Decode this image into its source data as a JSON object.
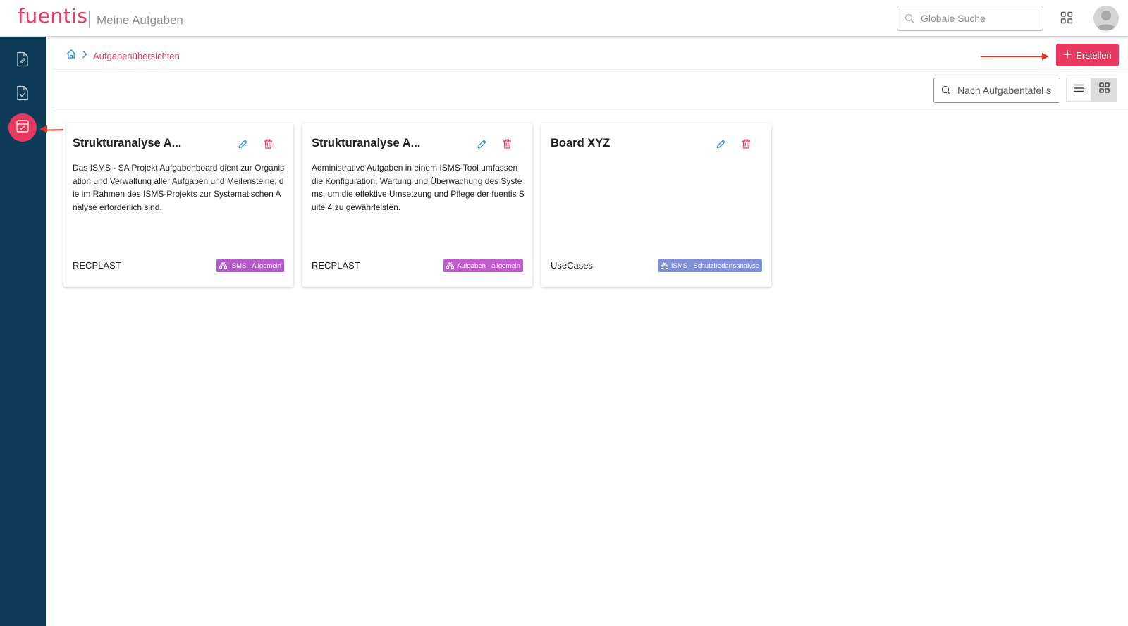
{
  "header": {
    "logo": "fuentis",
    "title": "Meine Aufgaben",
    "search_placeholder": "Globale Suche",
    "apps_icon": "grid-icon",
    "avatar_icon": "user-avatar-icon"
  },
  "sidebar": {
    "items": [
      {
        "name": "documents",
        "icon": "document-edit-icon",
        "active": false
      },
      {
        "name": "tasks",
        "icon": "document-check-icon",
        "active": false
      },
      {
        "name": "task-boards",
        "icon": "board-icon",
        "active": true
      }
    ]
  },
  "breadcrumb": {
    "home_icon": "home-icon",
    "separator_icon": "chevron-right-icon",
    "current": "Aufgabenübersichten"
  },
  "toolbar": {
    "create_label": "Erstellen",
    "create_icon": "plus-icon",
    "board_search_placeholder": "Nach Aufgabentafel s",
    "list_view_icon": "list-icon",
    "grid_view_icon": "grid-icon",
    "active_view": "grid"
  },
  "cards": [
    {
      "title": "Strukturanalyse A...",
      "description": "Das ISMS - SA Projekt Aufgabenboard dient zur Organisation und Verwaltung aller Aufgaben und Meilensteine, die im Rahmen des ISMS-Projekts zur Systematischen Analyse erforderlich sind.",
      "owner": "RECPLAST",
      "tag": "ISMS - Allgemein",
      "tag_color": "#b45bc9"
    },
    {
      "title": "Strukturanalyse A...",
      "description": "Administrative Aufgaben in einem ISMS-Tool umfassen die Konfiguration, Wartung und Überwachung des Systems, um die effektive Umsetzung und Pflege der fuentis Suite 4 zu gewährleisten.",
      "owner": "RECPLAST",
      "tag": "Aufgaben - allgemein",
      "tag_color": "#c25ccc"
    },
    {
      "title": "Board XYZ",
      "description": "",
      "owner": "UseCases",
      "tag": "ISMS - Schutzbedarfsanalyse",
      "tag_color": "#7f8fd8"
    }
  ],
  "colors": {
    "brand": "#e8385f",
    "sidebar_bg": "#0c3a57",
    "edit_icon": "#2e8fd1",
    "delete_icon": "#e8385f",
    "annotation_arrow": "#e63422"
  }
}
